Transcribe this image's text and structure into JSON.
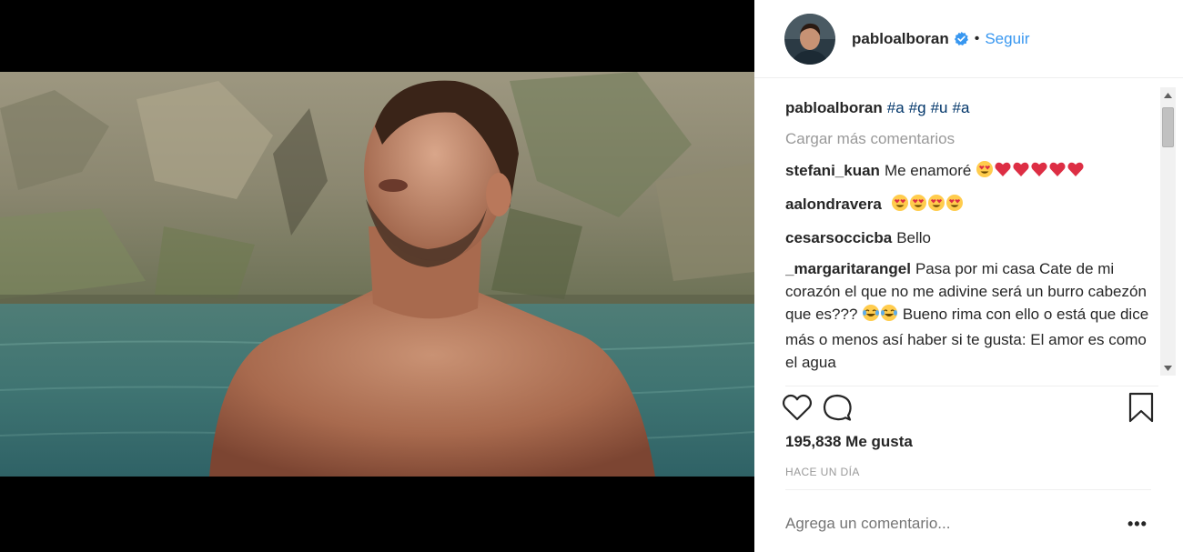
{
  "post": {
    "username": "pabloalboran",
    "follow_label": "Seguir",
    "separator": "•",
    "caption": {
      "username": "pabloalboran",
      "hashtags": [
        "#a",
        "#g",
        "#u",
        "#a"
      ]
    },
    "load_more_label": "Cargar más comentarios",
    "comments": [
      {
        "username": "stefani_kuan",
        "text": "Me enamoré",
        "emoji": [
          "heart-eyes",
          "red-heart",
          "red-heart",
          "red-heart",
          "red-heart",
          "red-heart"
        ]
      },
      {
        "username": "aalondravera",
        "text": "",
        "emoji": [
          "heart-eyes",
          "heart-eyes",
          "heart-eyes",
          "heart-eyes"
        ]
      },
      {
        "username": "cesarsoccicba",
        "text": "Bello",
        "emoji": []
      },
      {
        "username": "_margaritarangel",
        "text": "Pasa por mi casa Cate de mi corazón el que no me adivine será un burro cabezón que es???",
        "emoji": [
          "tears-of-joy",
          "tears-of-joy"
        ],
        "text_after": "Bueno rima con ello o está que dice más o menos así haber si te gusta: El amor es como el agua"
      }
    ],
    "likes_label": "195,838 Me gusta",
    "time_label": "HACE UN DÍA",
    "add_comment_placeholder": "Agrega un comentario...",
    "more_label": "•••"
  },
  "icons": {
    "verified": "verified-badge-icon",
    "like": "heart-outline-icon",
    "comment": "speech-bubble-icon",
    "save": "bookmark-icon",
    "scroll_up": "arrow-up-icon",
    "scroll_down": "arrow-down-icon"
  },
  "colors": {
    "link_blue": "#3897f0",
    "hashtag": "#003569",
    "muted": "#999999",
    "text": "#262626",
    "verified": "#3897f0"
  }
}
